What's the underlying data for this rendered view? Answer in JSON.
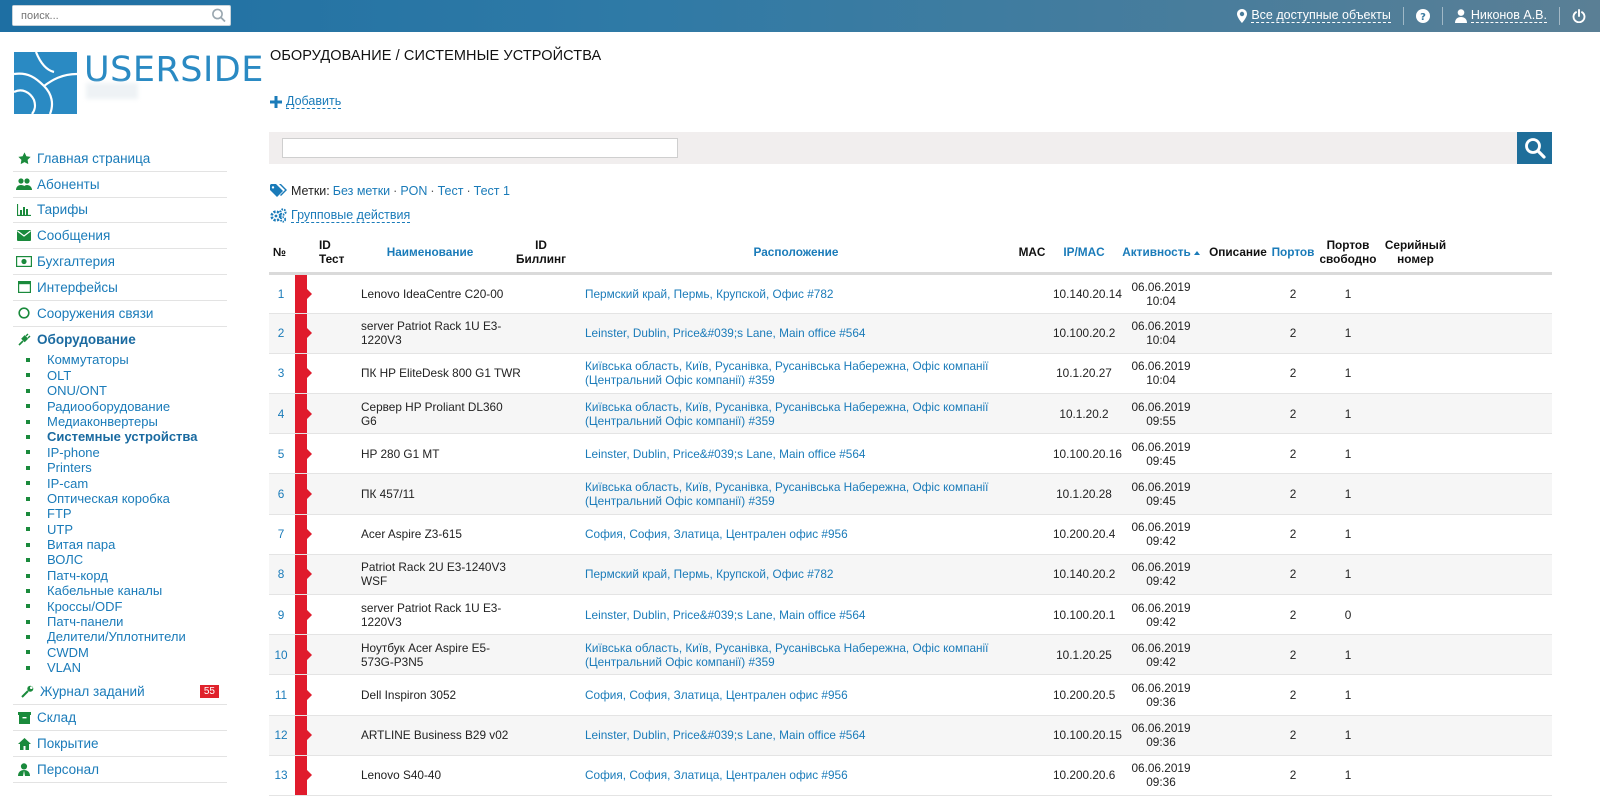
{
  "topbar": {
    "search_placeholder": "поиск...",
    "objects_label": "Все доступные объекты",
    "user_name": "Никонов А.В."
  },
  "logo": {
    "text": "USERSIDE"
  },
  "sidebar": {
    "items_top": [
      {
        "label": "Главная страница",
        "icon": "star-icon"
      },
      {
        "label": "Абоненты",
        "icon": "users-icon"
      },
      {
        "label": "Тарифы",
        "icon": "bar-chart-icon"
      },
      {
        "label": "Сообщения",
        "icon": "envelope-icon"
      },
      {
        "label": "Бухгалтерия",
        "icon": "money-icon"
      },
      {
        "label": "Интерфейсы",
        "icon": "window-icon"
      },
      {
        "label": "Сооружения связи",
        "icon": "circle-icon"
      },
      {
        "label": "Оборудование",
        "icon": "plug-icon"
      }
    ],
    "equipment_sub": [
      "Коммутаторы",
      "OLT",
      "ONU/ONT",
      "Радиооборудование",
      "Медиаконвертеры",
      "Системные устройства",
      "IP-phone",
      "Printers",
      "IP-cam",
      "Оптическая коробка",
      "FTP",
      "UTP",
      "Витая пара",
      "ВОЛС",
      "Патч-корд",
      "Кабельные каналы",
      "Кроссы/ODF",
      "Патч-панели",
      "Делители/Уплотнители",
      "CWDM",
      "VLAN"
    ],
    "current_sub": "Системные устройства",
    "items_bottom": [
      {
        "label": "Журнал заданий",
        "icon": "wrench-icon",
        "badge": "55"
      },
      {
        "label": "Склад",
        "icon": "warehouse-icon"
      },
      {
        "label": "Покрытие",
        "icon": "home-icon"
      },
      {
        "label": "Персонал",
        "icon": "staff-icon"
      }
    ]
  },
  "main": {
    "title": "ОБОРУДОВАНИЕ / СИСТЕМНЫЕ УСТРОЙСТВА",
    "add_label": "Добавить",
    "tags_label": "Метки:",
    "tags": [
      "Без метки",
      "PON",
      "Тест",
      "Тест 1"
    ],
    "group_actions": "Групповые действия",
    "columns": {
      "num": "№",
      "id_test_1": "ID",
      "id_test_2": "Тест",
      "name": "Наименование",
      "id_bill_1": "ID",
      "id_bill_2": "Биллинг",
      "location": "Расположение",
      "mac": "MAC",
      "ipmac": "IP/MAC",
      "activity": "Активность",
      "description": "Описание",
      "ports": "Портов",
      "ports_free_1": "Портов",
      "ports_free_2": "свободно",
      "serial_1": "Серийный",
      "serial_2": "номер"
    },
    "rows": [
      {
        "num": "1",
        "name": "Lenovo IdeaCentre C20-00",
        "location": "Пермский край, Пермь, Крупской, Офис #782",
        "ip": "10.140.20.14",
        "date": "06.06.2019",
        "time": "10:04",
        "ports": "2",
        "free": "1"
      },
      {
        "num": "2",
        "name": "server Patriot Rack 1U E3-1220V3",
        "location": "Leinster, Dublin, Price&#039;s Lane, Main office #564",
        "ip": "10.100.20.2",
        "date": "06.06.2019",
        "time": "10:04",
        "ports": "2",
        "free": "1"
      },
      {
        "num": "3",
        "name": "ПК HP EliteDesk 800 G1 TWR",
        "location": "Київська область, Київ, Русанівка, Русанівська Набережна, Офіс компанії (Центральний Офіс компанії) #359",
        "ip": "10.1.20.27",
        "date": "06.06.2019",
        "time": "10:04",
        "ports": "2",
        "free": "1"
      },
      {
        "num": "4",
        "name": "Сервер HP Proliant DL360 G6",
        "location": "Київська область, Київ, Русанівка, Русанівська Набережна, Офіс компанії (Центральний Офіс компанії) #359",
        "ip": "10.1.20.2",
        "date": "06.06.2019",
        "time": "09:55",
        "ports": "2",
        "free": "1"
      },
      {
        "num": "5",
        "name": "HP 280 G1 MT",
        "location": "Leinster, Dublin, Price&#039;s Lane, Main office #564",
        "ip": "10.100.20.16",
        "date": "06.06.2019",
        "time": "09:45",
        "ports": "2",
        "free": "1"
      },
      {
        "num": "6",
        "name": "ПК 457/11",
        "location": "Київська область, Київ, Русанівка, Русанівська Набережна, Офіс компанії (Центральний Офіс компанії) #359",
        "ip": "10.1.20.28",
        "date": "06.06.2019",
        "time": "09:45",
        "ports": "2",
        "free": "1"
      },
      {
        "num": "7",
        "name": "Acer Aspire Z3-615",
        "location": "София, София, Златица, Централен офис #956",
        "ip": "10.200.20.4",
        "date": "06.06.2019",
        "time": "09:42",
        "ports": "2",
        "free": "1"
      },
      {
        "num": "8",
        "name": "Patriot Rack 2U E3-1240V3 WSF",
        "location": "Пермский край, Пермь, Крупской, Офис #782",
        "ip": "10.140.20.2",
        "date": "06.06.2019",
        "time": "09:42",
        "ports": "2",
        "free": "1"
      },
      {
        "num": "9",
        "name": "server Patriot Rack 1U E3-1220V3",
        "location": "Leinster, Dublin, Price&#039;s Lane, Main office #564",
        "ip": "10.100.20.1",
        "date": "06.06.2019",
        "time": "09:42",
        "ports": "2",
        "free": "0"
      },
      {
        "num": "10",
        "name": "Ноутбук Acer Aspire E5-573G-P3N5",
        "location": "Київська область, Київ, Русанівка, Русанівська Набережна, Офіс компанії (Центральний Офіс компанії) #359",
        "ip": "10.1.20.25",
        "date": "06.06.2019",
        "time": "09:42",
        "ports": "2",
        "free": "1"
      },
      {
        "num": "11",
        "name": "Dell Inspiron 3052",
        "location": "София, София, Златица, Централен офис #956",
        "ip": "10.200.20.5",
        "date": "06.06.2019",
        "time": "09:36",
        "ports": "2",
        "free": "1"
      },
      {
        "num": "12",
        "name": "ARTLINE Business B29 v02",
        "location": "Leinster, Dublin, Price&#039;s Lane, Main office #564",
        "ip": "10.100.20.15",
        "date": "06.06.2019",
        "time": "09:36",
        "ports": "2",
        "free": "1"
      },
      {
        "num": "13",
        "name": "Lenovo S40-40",
        "location": "София, София, Златица, Централен офис #956",
        "ip": "10.200.20.6",
        "date": "06.06.2019",
        "time": "09:36",
        "ports": "2",
        "free": "1"
      }
    ]
  },
  "colors": {
    "accent": "#1a7bb9",
    "flag": "#e01b2c",
    "topbar": "#1e6fa3",
    "badge": "#e0222c"
  }
}
